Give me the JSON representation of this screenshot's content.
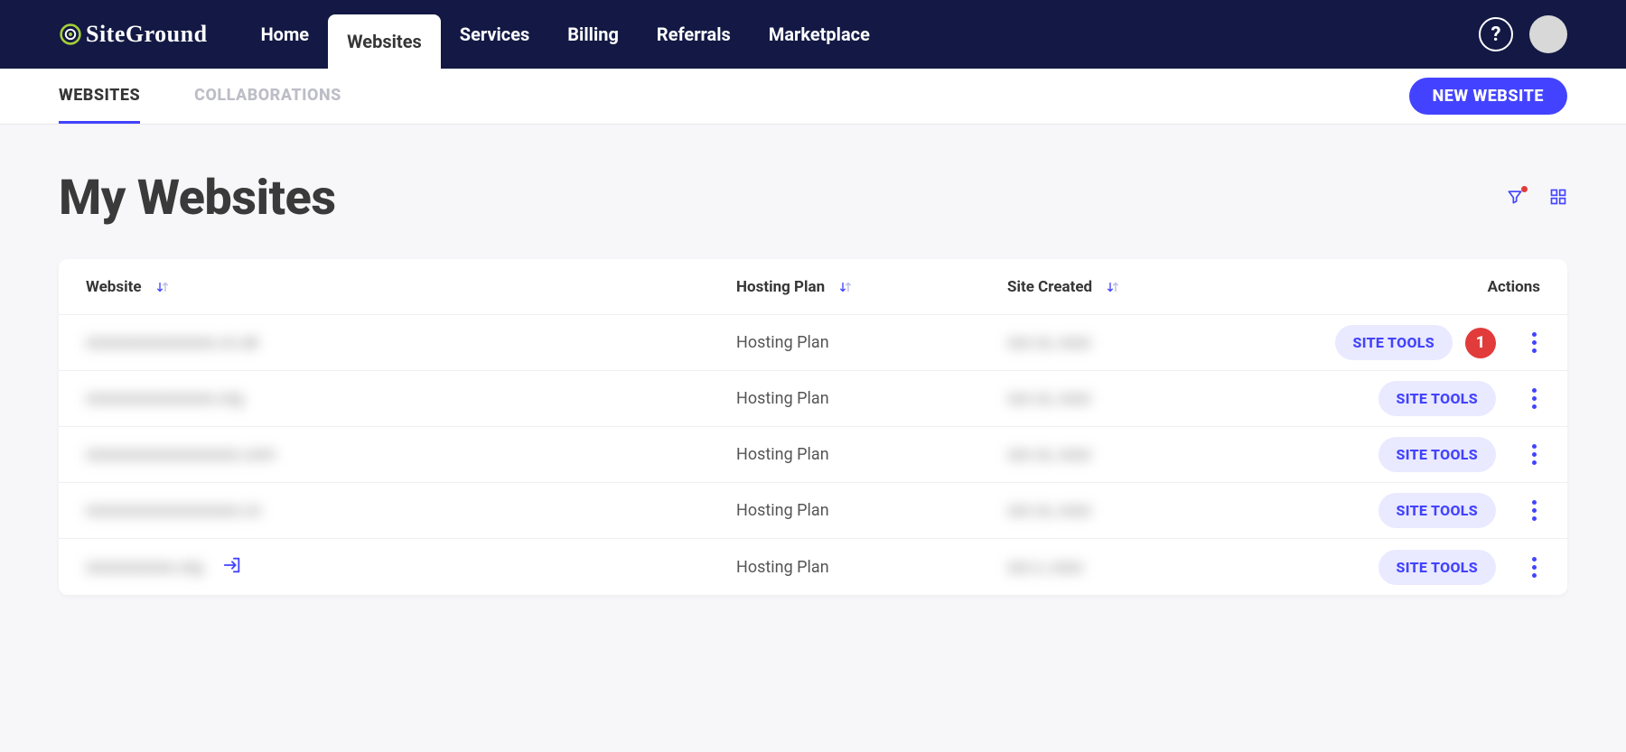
{
  "brand": {
    "name": "SiteGround"
  },
  "top_nav": {
    "items": [
      {
        "label": "Home"
      },
      {
        "label": "Websites"
      },
      {
        "label": "Services"
      },
      {
        "label": "Billing"
      },
      {
        "label": "Referrals"
      },
      {
        "label": "Marketplace"
      }
    ],
    "active_index": 1,
    "help_label": "?"
  },
  "subnav": {
    "tabs": [
      {
        "label": "WEBSITES"
      },
      {
        "label": "COLLABORATIONS"
      }
    ],
    "active_index": 0,
    "new_btn": "NEW WEBSITE"
  },
  "page": {
    "title": "My Websites"
  },
  "table": {
    "headers": {
      "website": "Website",
      "plan": "Hosting Plan",
      "created": "Site Created",
      "actions": "Actions"
    },
    "site_tools_label": "SITE TOOLS",
    "rows": [
      {
        "website_masked": "xxxxxxxxxxxxxxxx.co.uk",
        "plan": "Hosting Plan",
        "created_masked": "xxx xx, xxxx",
        "has_badge": true,
        "badge": "1",
        "has_ext": false
      },
      {
        "website_masked": "xxxxxxxxxxxxxxxx.org",
        "plan": "Hosting Plan",
        "created_masked": "xxx xx, xxxx",
        "has_badge": false,
        "has_ext": false
      },
      {
        "website_masked": "xxxxxxxxxxxxxxxxxxx.com",
        "plan": "Hosting Plan",
        "created_masked": "xxx xx, xxxx",
        "has_badge": false,
        "has_ext": false
      },
      {
        "website_masked": "xxxxxxxxxxxxxxxxxxx.co",
        "plan": "Hosting Plan",
        "created_masked": "xxx xx, xxxx",
        "has_badge": false,
        "has_ext": false
      },
      {
        "website_masked": "xxxxxxxxxxx.org",
        "plan": "Hosting Plan",
        "created_masked": "xxx x, xxxx",
        "has_badge": false,
        "has_ext": true
      }
    ]
  }
}
